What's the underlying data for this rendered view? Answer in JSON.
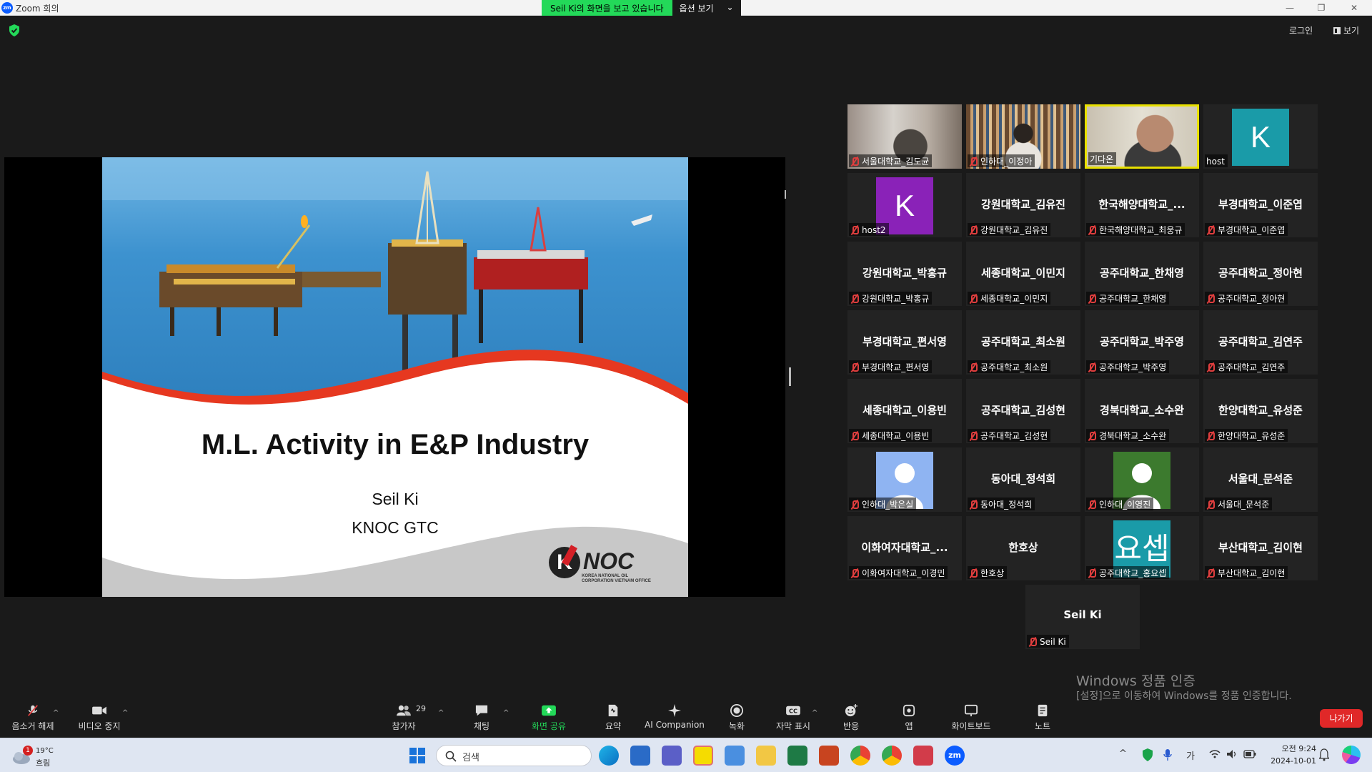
{
  "window": {
    "title": "Zoom 회의",
    "app_icon": "zm",
    "minimize": "—",
    "restore": "❐",
    "close": "✕"
  },
  "share_banner": {
    "viewing_text": "Seil Ki의 화면을 보고 있습니다",
    "view_options": "옵션 보기",
    "caret": "⌄"
  },
  "top_right": {
    "login": "로그인",
    "view": "보기"
  },
  "slide": {
    "title": "M.L. Activity in E&P Industry",
    "presenter": "Seil Ki",
    "org": "KNOC GTC",
    "logo_mark": "K",
    "logo_word": "NOC",
    "logo_sub_1": "KOREA NATIONAL OIL",
    "logo_sub_2": "CORPORATION VIETNAM OFFICE"
  },
  "gallery": [
    {
      "big": "",
      "tag": "서울대학교_김도균",
      "type": "photo",
      "muted": true
    },
    {
      "big": "",
      "tag": "인하대_이정아",
      "type": "photo",
      "muted": true
    },
    {
      "big": "",
      "tag": "기다온",
      "type": "photo",
      "muted": false,
      "speaking": true
    },
    {
      "big": "",
      "tag": "host",
      "type": "avatar",
      "avatar": "K",
      "avatar_color": "#1a9ba8",
      "muted": false
    },
    {
      "big": "",
      "tag": "host2",
      "type": "avatar",
      "avatar": "K",
      "avatar_color": "#8a22b8",
      "muted": true
    },
    {
      "big": "강원대학교_김유진",
      "tag": "강원대학교_김유진",
      "type": "name",
      "muted": true
    },
    {
      "big": "한국해양대학교_...",
      "tag": "한국해양대학교_최웅규",
      "type": "name",
      "muted": true
    },
    {
      "big": "부경대학교_이준엽",
      "tag": "부경대학교_이준엽",
      "type": "name",
      "muted": true
    },
    {
      "big": "강원대학교_박홍규",
      "tag": "강원대학교_박홍규",
      "type": "name",
      "muted": true
    },
    {
      "big": "세종대학교_이민지",
      "tag": "세종대학교_이민지",
      "type": "name",
      "muted": true
    },
    {
      "big": "공주대학교_한채영",
      "tag": "공주대학교_한채영",
      "type": "name",
      "muted": true
    },
    {
      "big": "공주대학교_정아현",
      "tag": "공주대학교_정아현",
      "type": "name",
      "muted": true
    },
    {
      "big": "부경대학교_편서영",
      "tag": "부경대학교_편서영",
      "type": "name",
      "muted": true
    },
    {
      "big": "공주대학교_최소원",
      "tag": "공주대학교_최소원",
      "type": "name",
      "muted": true
    },
    {
      "big": "공주대학교_박주영",
      "tag": "공주대학교_박주영",
      "type": "name",
      "muted": true
    },
    {
      "big": "공주대학교_김연주",
      "tag": "공주대학교_김연주",
      "type": "name",
      "muted": true
    },
    {
      "big": "세종대학교_이용빈",
      "tag": "세종대학교_이용빈",
      "type": "name",
      "muted": true
    },
    {
      "big": "공주대학교_김성현",
      "tag": "공주대학교_김성현",
      "type": "name",
      "muted": true
    },
    {
      "big": "경북대학교_소수완",
      "tag": "경북대학교_소수완",
      "type": "name",
      "muted": true
    },
    {
      "big": "한양대학교_유성준",
      "tag": "한양대학교_유성준",
      "type": "name",
      "muted": true
    },
    {
      "big": "",
      "tag": "인하대_박은실",
      "type": "person",
      "avatar_color": "#8fb4f2",
      "muted": true
    },
    {
      "big": "동아대_정석희",
      "tag": "동아대_정석희",
      "type": "name",
      "muted": true
    },
    {
      "big": "",
      "tag": "인하대_이영진",
      "type": "person",
      "avatar_color": "#3c7a2e",
      "muted": true
    },
    {
      "big": "서울대_문석준",
      "tag": "서울대_문석준",
      "type": "name",
      "muted": true
    },
    {
      "big": "이화여자대학교_...",
      "tag": "이화여자대학교_이경민",
      "type": "name",
      "muted": true
    },
    {
      "big": "한호상",
      "tag": "한호상",
      "type": "name",
      "muted": true
    },
    {
      "big": "",
      "tag": "공주대학교_홍요셉",
      "type": "avatar",
      "avatar": "요셉",
      "avatar_color": "#1a9ba8",
      "muted": true
    },
    {
      "big": "부산대학교_김이현",
      "tag": "부산대학교_김이현",
      "type": "name",
      "muted": true
    },
    {
      "big": "Seil Ki",
      "tag": "Seil Ki",
      "type": "name",
      "muted": true
    }
  ],
  "toolbar": {
    "unmute": "음소거 해제",
    "stop_video": "비디오 중지",
    "participants": "참가자",
    "participants_count": "29",
    "chat": "채팅",
    "share_screen": "화면 공유",
    "summary": "요약",
    "ai_companion": "AI Companion",
    "record": "녹화",
    "captions": "자막 표시",
    "reactions": "반응",
    "apps": "앱",
    "whiteboard": "화이트보드",
    "notes": "노트",
    "leave": "나가기",
    "caret": "^"
  },
  "watermark": {
    "line1": "Windows 정품 인증",
    "line2": "[설정]으로 이동하여 Windows를 정품 인증합니다."
  },
  "taskbar": {
    "weather_temp": "19°C",
    "weather_cond": "흐림",
    "weather_badge": "1",
    "search_placeholder": "검색",
    "ime": "가",
    "time": "오전 9:24",
    "date": "2024-10-01",
    "tray_up": "^"
  },
  "colors": {
    "zoom_green": "#23d959",
    "leave_red": "#e02828",
    "speaker_yellow": "#e8e000",
    "muted_red": "#e03e3e"
  }
}
